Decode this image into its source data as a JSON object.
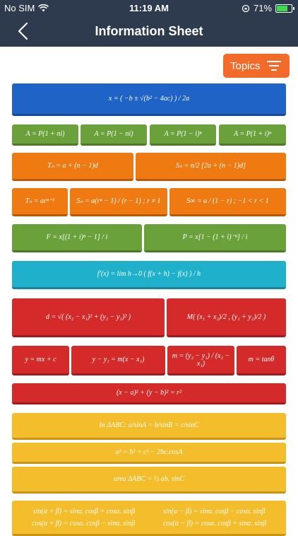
{
  "status": {
    "carrier": "No SIM",
    "time": "11:19 AM",
    "battery": "71%",
    "battery_level": 0.71
  },
  "nav": {
    "title": "Information Sheet"
  },
  "topics_button": {
    "label": "Topics"
  },
  "formulas": {
    "quadratic": "x = ( −b ± √(b² − 4ac) ) / 2a",
    "interest_1": "A = P(1 + ni)",
    "interest_2": "A = P(1 − ni)",
    "interest_3": "A = P(1 − i)ⁿ",
    "interest_4": "A = P(1 + i)ⁿ",
    "arith_term": "Tₙ = a + (n − 1)d",
    "arith_sum": "Sₙ = n/2 [2a + (n − 1)d]",
    "geom_term": "Tₙ = arⁿ⁻¹",
    "geom_sum": "Sₙ = a(rⁿ − 1) / (r − 1) ;  r ≠ 1",
    "geom_inf": "S∞ = a / (1 − r) ;  −1 < r < 1",
    "future_value": "F = x[(1 + i)ⁿ − 1] / i",
    "present_value": "P = x[1 − (1 + i)⁻ⁿ] / i",
    "derivative": "f′(x) = lim h→0  ( f(x + h) − f(x) ) / h",
    "distance": "d = √( (x₂ − x₁)² + (y₂ − y₁)² )",
    "midpoint": "M( (x₁ + x₂)/2 , (y₁ + y₂)/2 )",
    "line_1": "y = mx + c",
    "line_2": "y − y₁ = m(x − x₁)",
    "gradient": "m = (y₂ − y₁) / (x₂ − x₁)",
    "tan": "m = tanθ",
    "circle": "(x − a)² + (y − b)² = r²",
    "sine_rule": "In ΔABC:   a/sinA = b/sinB = c/sinC",
    "cosine_rule": "a² = b² + c² − 2bc.cosA",
    "area_rule": "area ΔABC = ½ ab. sinC",
    "compound_1": "sin(α + β) = sinα. cosβ + cosα. sinβ",
    "compound_2": "sin(α − β) = sinα. cosβ − cosα. sinβ",
    "compound_3": "cos(α + β) = cosα. cosβ − sinα. sinβ",
    "compound_4": "cos(α − β) = cosα. cosβ + sinα. sinβ"
  }
}
